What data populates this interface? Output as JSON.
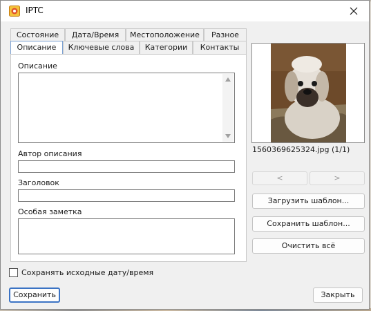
{
  "window": {
    "title": "IPTC",
    "app_icon": "photo-app-icon",
    "close_icon": "close-icon"
  },
  "tabs_back": [
    {
      "label": "Состояние"
    },
    {
      "label": "Дата/Время"
    },
    {
      "label": "Местоположение"
    },
    {
      "label": "Разное"
    }
  ],
  "tabs_front": [
    {
      "label": "Описание",
      "active": true
    },
    {
      "label": "Ключевые слова"
    },
    {
      "label": "Категории"
    },
    {
      "label": "Контакты"
    }
  ],
  "form": {
    "description_label": "Описание",
    "description_value": "",
    "author_label": "Автор описания",
    "author_value": "",
    "headline_label": "Заголовок",
    "headline_value": "",
    "special_label": "Особая заметка",
    "special_value": ""
  },
  "preview": {
    "filename": "1560369625324.jpg (1/1)",
    "image_icon": "dog-photo-thumbnail"
  },
  "nav": {
    "prev_label": "<",
    "next_label": ">"
  },
  "buttons": {
    "load_template": "Загрузить шаблон...",
    "save_template": "Сохранить шаблон...",
    "clear_all": "Очистить всё",
    "save": "Сохранить",
    "close": "Закрыть"
  },
  "options": {
    "keep_date_label": "Сохранять исходные дату/время",
    "keep_date_checked": false
  },
  "colors": {
    "accent": "#3b73c4",
    "dialog_bg": "#f0f0f0",
    "panel_bg": "#ffffff"
  }
}
